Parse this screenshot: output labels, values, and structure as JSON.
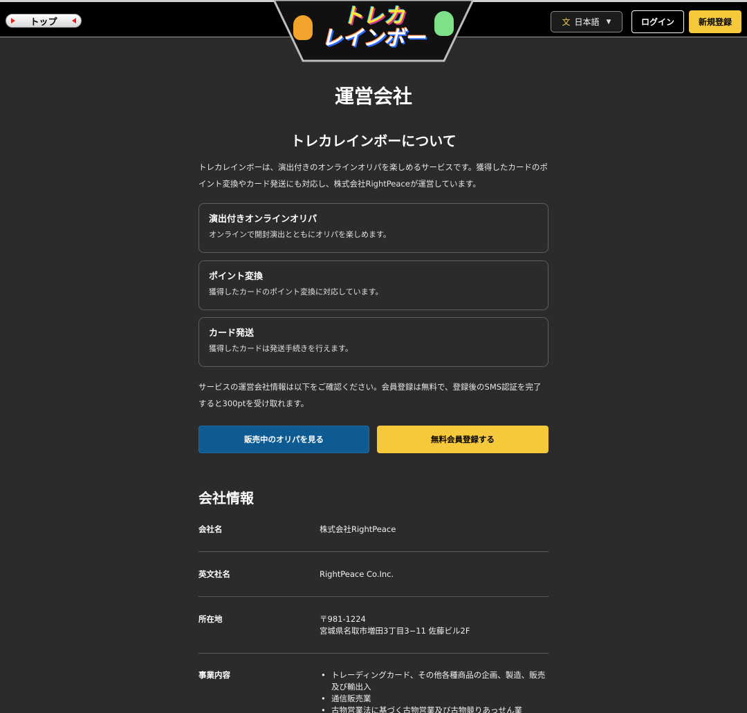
{
  "header": {
    "top_button": "トップ",
    "logo_line1": "トレカ",
    "logo_line2": "レインボー",
    "language": "日本語",
    "language_icon": "translate-icon",
    "login": "ログイン",
    "signup": "新規登録"
  },
  "page": {
    "title": "運営会社",
    "about_title": "トレカレインボーについて",
    "intro": "トレカレインボーは、演出付きのオンラインオリパを楽しめるサービスです。獲得したカードのポイント変換やカード発送にも対応し、株式会社RightPeaceが運営しています。",
    "features": [
      {
        "title": "演出付きオンラインオリパ",
        "desc": "オンラインで開封演出とともにオリパを楽しめます。"
      },
      {
        "title": "ポイント変換",
        "desc": "獲得したカードのポイント変換に対応しています。"
      },
      {
        "title": "カード発送",
        "desc": "獲得したカードは発送手続きを行えます。"
      }
    ],
    "notice": "サービスの運営会社情報は以下をご確認ください。会員登録は無料で、登録後のSMS認証を完了すると300ptを受け取れます。",
    "btn_oripa": "販売中のオリパを見る",
    "btn_free": "無料会員登録する",
    "company_title": "会社情報"
  },
  "company": {
    "name_label": "会社名",
    "name_value": "株式会社RightPeace",
    "en_label": "英文社名",
    "en_value": "RightPeace Co.Inc.",
    "addr_label": "所在地",
    "addr_zip": "〒981-1224",
    "addr_line": "宮城県名取市増田3丁目3−11 佐藤ビル2F",
    "biz_label": "事業内容",
    "biz_items": [
      "トレーディングカード、その他各種商品の企画、製造、販売及び輸出入",
      "通信販売業",
      "古物営業法に基づく古物営業及び古物競りあっせん業"
    ]
  },
  "colors": {
    "background": "#2b2b2b",
    "accent_yellow": "#f6c93c",
    "accent_blue": "#0e5a92"
  }
}
